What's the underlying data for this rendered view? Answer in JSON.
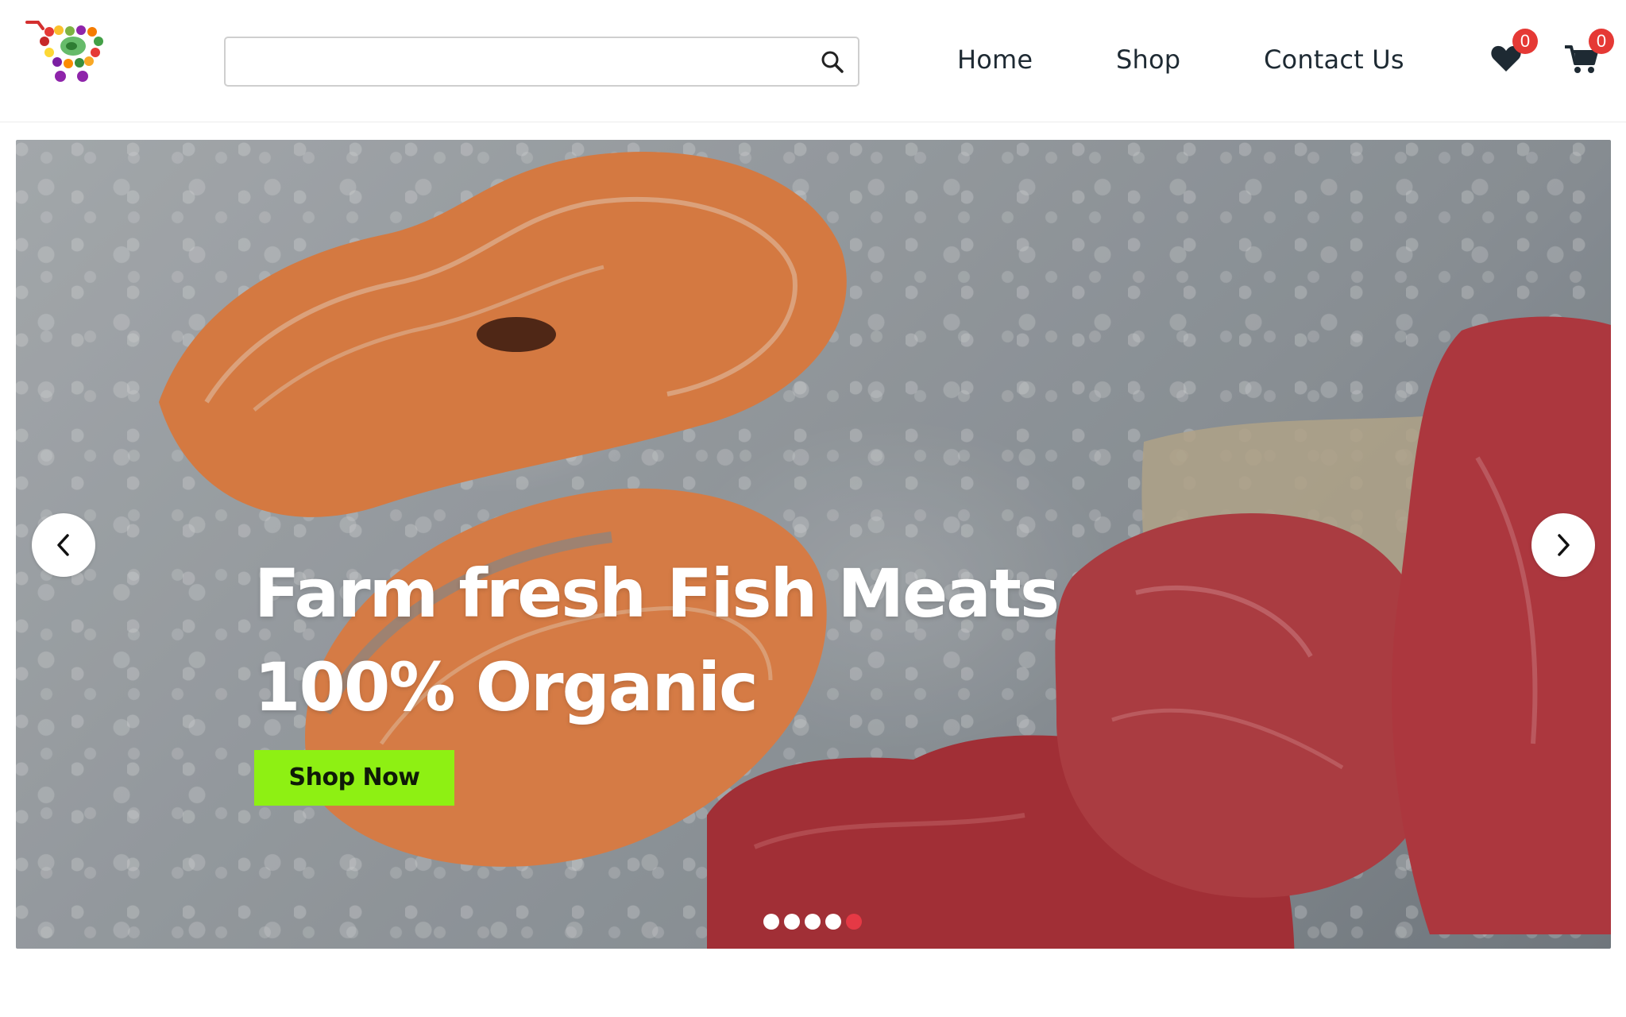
{
  "header": {
    "search": {
      "value": "",
      "placeholder": ""
    },
    "nav": {
      "home": "Home",
      "shop": "Shop",
      "contact": "Contact Us"
    },
    "wishlist_count": "0",
    "cart_count": "0"
  },
  "hero": {
    "title_line1": "Farm fresh Fish Meats",
    "title_line2": "100% Organic",
    "cta_label": "Shop Now",
    "slide_count": 5,
    "active_slide_index": 4
  },
  "colors": {
    "cta_bg": "#8ef013",
    "badge_bg": "#e53935",
    "active_dot": "#e53945",
    "nav_text": "#1e2a33"
  },
  "icons": {
    "logo": "fruit-cart-logo",
    "search": "search-icon",
    "wishlist": "heart-icon",
    "cart": "shopping-cart-icon",
    "prev": "chevron-left-icon",
    "next": "chevron-right-icon"
  }
}
